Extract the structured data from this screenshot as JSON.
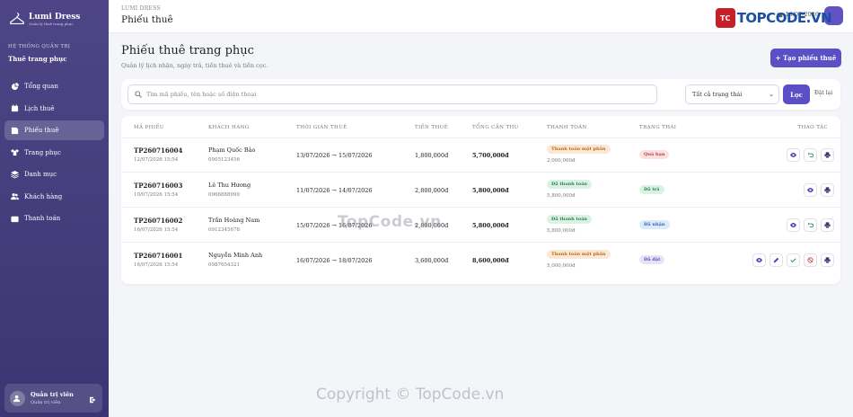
{
  "sidebar": {
    "brand_name": "Lumi Dress",
    "brand_sub": "Quản lý thuê trang phục",
    "section_label": "Hệ thống quản trị",
    "section_title": "Thuê trang phục",
    "items": [
      {
        "label": "Tổng quan",
        "icon": "dashboard-icon"
      },
      {
        "label": "Lịch thuê",
        "icon": "calendar-icon"
      },
      {
        "label": "Phiếu thuê",
        "icon": "receipt-icon",
        "active": true
      },
      {
        "label": "Trang phục",
        "icon": "shirt-icon"
      },
      {
        "label": "Danh mục",
        "icon": "layers-icon"
      },
      {
        "label": "Khách hàng",
        "icon": "users-icon"
      },
      {
        "label": "Thanh toán",
        "icon": "wallet-icon"
      }
    ],
    "user_name": "Quản trị viên",
    "user_role": "Quản trị viên"
  },
  "topbar": {
    "sub": "LUMI DRESS",
    "title": "Phiếu thuê",
    "date": "16/07/2026"
  },
  "watermark": {
    "logo_badge": "TC",
    "logo_text": "TOPCODE.VN",
    "mid": "TopCode.vn",
    "bottom": "Copyright © TopCode.vn"
  },
  "page": {
    "title": "Phiếu thuê trang phục",
    "subtitle": "Quản lý lịch nhận, ngày trả, tiền thuê và tiền cọc.",
    "create_label": "+ Tạo phiếu thuê"
  },
  "filter": {
    "search_placeholder": "Tìm mã phiếu, tên hoặc số điện thoại",
    "status_value": "Tất cả trạng thái",
    "filter_label": "Lọc",
    "reset_label": "Đặt lại"
  },
  "table": {
    "headers": [
      "Mã phiếu",
      "Khách hàng",
      "Thời gian thuê",
      "Tiền thuê",
      "Tổng cần thu",
      "Thanh toán",
      "Trạng thái",
      "Thao tác"
    ],
    "rows": [
      {
        "code": "TP260716004",
        "created": "12/07/2026 15:54",
        "customer": "Phạm Quốc Bảo",
        "phone": "0905123456",
        "period": "13/07/2026 → 15/07/2026",
        "rent": "1,800,000đ",
        "total": "5,700,000đ",
        "payment": "Thanh toán một phần",
        "paid": "2,000,000đ",
        "status": "Quá hạn"
      },
      {
        "code": "TP260716003",
        "created": "10/07/2026 15:54",
        "customer": "Lê Thu Hương",
        "phone": "0966888999",
        "period": "11/07/2026 → 14/07/2026",
        "rent": "2,800,000đ",
        "total": "5,800,000đ",
        "payment": "Đã thanh toán",
        "paid": "5,800,000đ",
        "status": "Đã trả"
      },
      {
        "code": "TP260716002",
        "created": "16/07/2026 15:54",
        "customer": "Trần Hoàng Nam",
        "phone": "0912345678",
        "period": "15/07/2026 → 16/07/2026",
        "rent": "2,800,000đ",
        "total": "5,800,000đ",
        "payment": "Đã thanh toán",
        "paid": "5,800,000đ",
        "status": "Đã nhận"
      },
      {
        "code": "TP260716001",
        "created": "16/07/2026 15:54",
        "customer": "Nguyễn Minh Anh",
        "phone": "0987654321",
        "period": "16/07/2026 → 18/07/2026",
        "rent": "3,600,000đ",
        "total": "8,600,000đ",
        "payment": "Thanh toán một phần",
        "paid": "5,000,000đ",
        "status": "Đã đặt"
      }
    ]
  },
  "colors": {
    "accent": "#5b4fc6",
    "sidebar": "#4e4586"
  }
}
